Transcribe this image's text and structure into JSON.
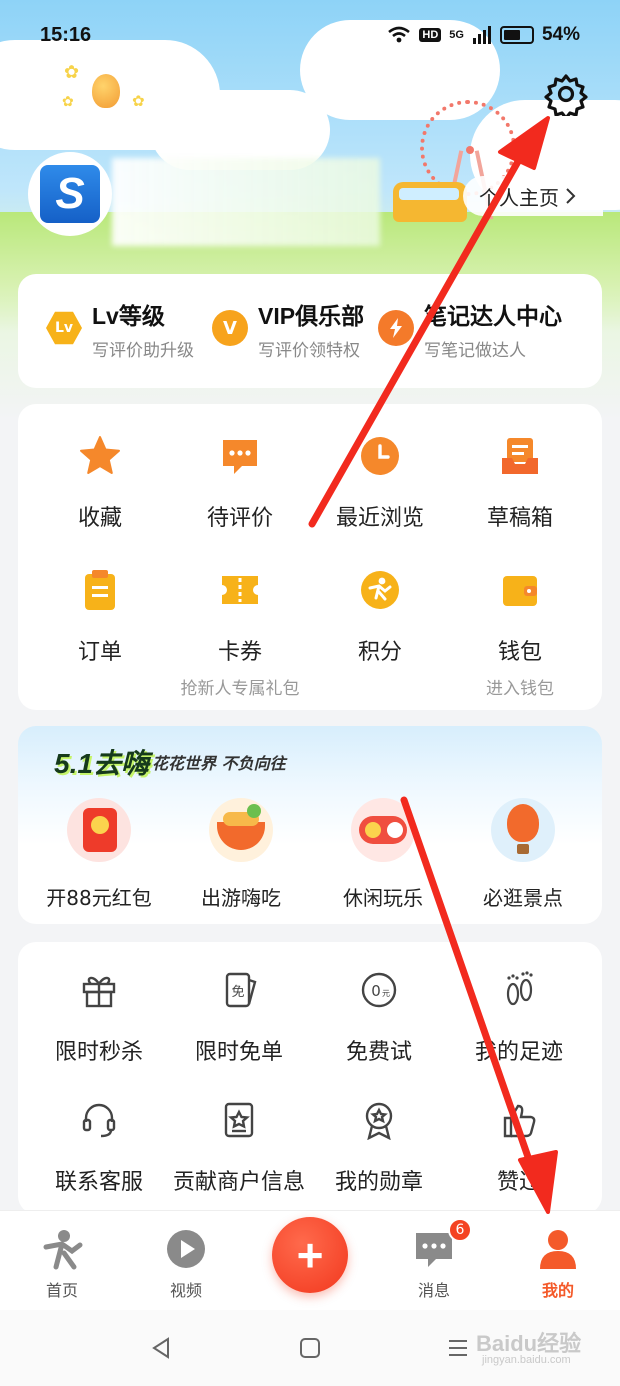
{
  "status_bar": {
    "time": "15:16",
    "hd": "HD",
    "network": "5G",
    "battery": "54%"
  },
  "profile": {
    "homepage_label": "个人主页"
  },
  "levels": [
    {
      "icon": "Lv",
      "title": "Lv等级",
      "subtitle": "写评价助升级"
    },
    {
      "icon": "V",
      "title": "VIP俱乐部",
      "subtitle": "写评价领特权"
    },
    {
      "icon": "",
      "title": "笔记达人中心",
      "subtitle": "写笔记做达人"
    }
  ],
  "grid": [
    {
      "label": "收藏",
      "sub": ""
    },
    {
      "label": "待评价",
      "sub": ""
    },
    {
      "label": "最近浏览",
      "sub": ""
    },
    {
      "label": "草稿箱",
      "sub": ""
    },
    {
      "label": "订单",
      "sub": ""
    },
    {
      "label": "卡券",
      "sub": "抢新人专属礼包"
    },
    {
      "label": "积分",
      "sub": ""
    },
    {
      "label": "钱包",
      "sub": "进入钱包"
    }
  ],
  "promo": {
    "title": "5.1去嗨",
    "subtitle": "花花世界 不负向往",
    "items": [
      {
        "label": "开88元红包"
      },
      {
        "label": "出游嗨吃"
      },
      {
        "label": "休闲玩乐"
      },
      {
        "label": "必逛景点"
      }
    ]
  },
  "tools": [
    {
      "label": "限时秒杀"
    },
    {
      "label": "限时免单"
    },
    {
      "label": "免费试"
    },
    {
      "label": "我的足迹"
    },
    {
      "label": "联系客服"
    },
    {
      "label": "贡献商户信息"
    },
    {
      "label": "我的勋章"
    },
    {
      "label": "赞过"
    }
  ],
  "bottom_nav": {
    "home": "首页",
    "video": "视频",
    "plus": "+",
    "messages": "消息",
    "messages_badge": "6",
    "mine": "我的"
  },
  "watermark": {
    "brand": "Baidu经验",
    "url": "jingyan.baidu.com"
  },
  "colors": {
    "accent": "#f45a2a",
    "annotation_arrow": "#f22a1e"
  }
}
